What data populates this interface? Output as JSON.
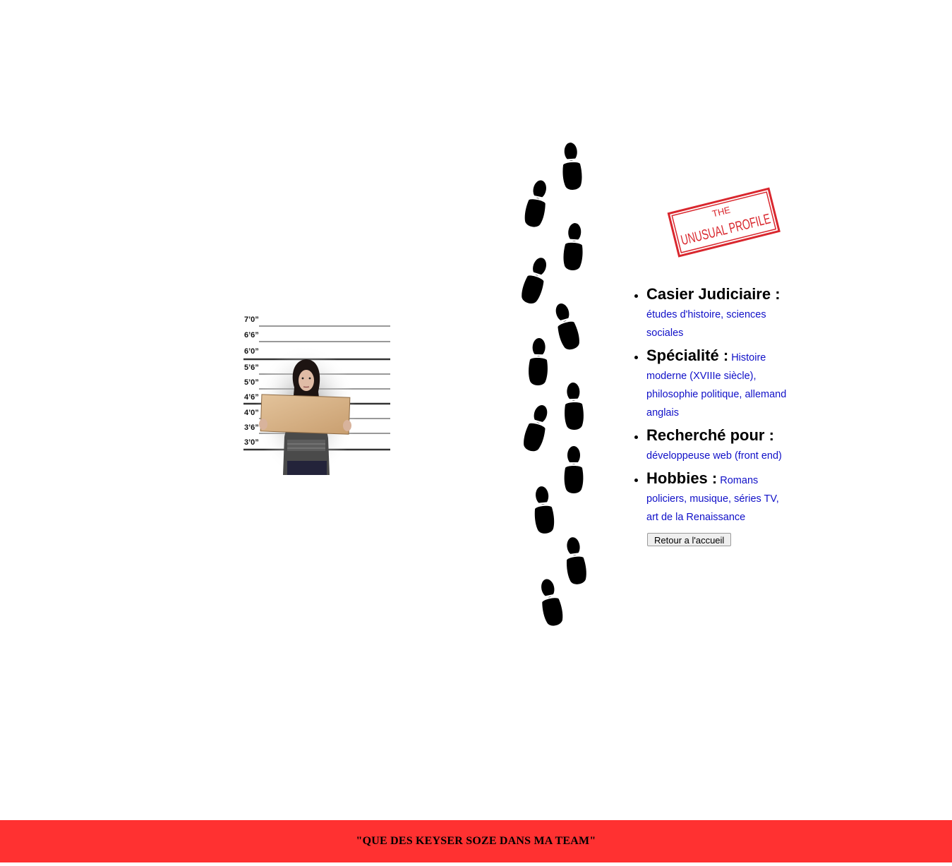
{
  "mugshot": {
    "height_marks": [
      "7’0”",
      "6’6”",
      "6’0”",
      "5’6”",
      "5’0”",
      "4’6”",
      "4’0”",
      "3’6”",
      "3’0”"
    ]
  },
  "stamp": {
    "line1": "THE",
    "line2": "UNUSUAL PROFILE",
    "color": "#d9272e"
  },
  "profile": {
    "items": [
      {
        "label": "Casier Judiciaire :",
        "value": "études d'histoire, sciences sociales"
      },
      {
        "label": "Spécialité :",
        "value": "Histoire moderne (XVIIIe siècle), philosophie politique, allemand anglais"
      },
      {
        "label": "Recherché pour :",
        "value": "développeuse web (front end)"
      },
      {
        "label": "Hobbies :",
        "value": "Romans policiers, musique, séries TV, art de la Renaissance"
      }
    ],
    "button_label": "Retour a l'accueil"
  },
  "footer": {
    "quote": "\"QUE DES KEYSER SOZE DANS MA TEAM\"",
    "background": "#ff3131"
  }
}
